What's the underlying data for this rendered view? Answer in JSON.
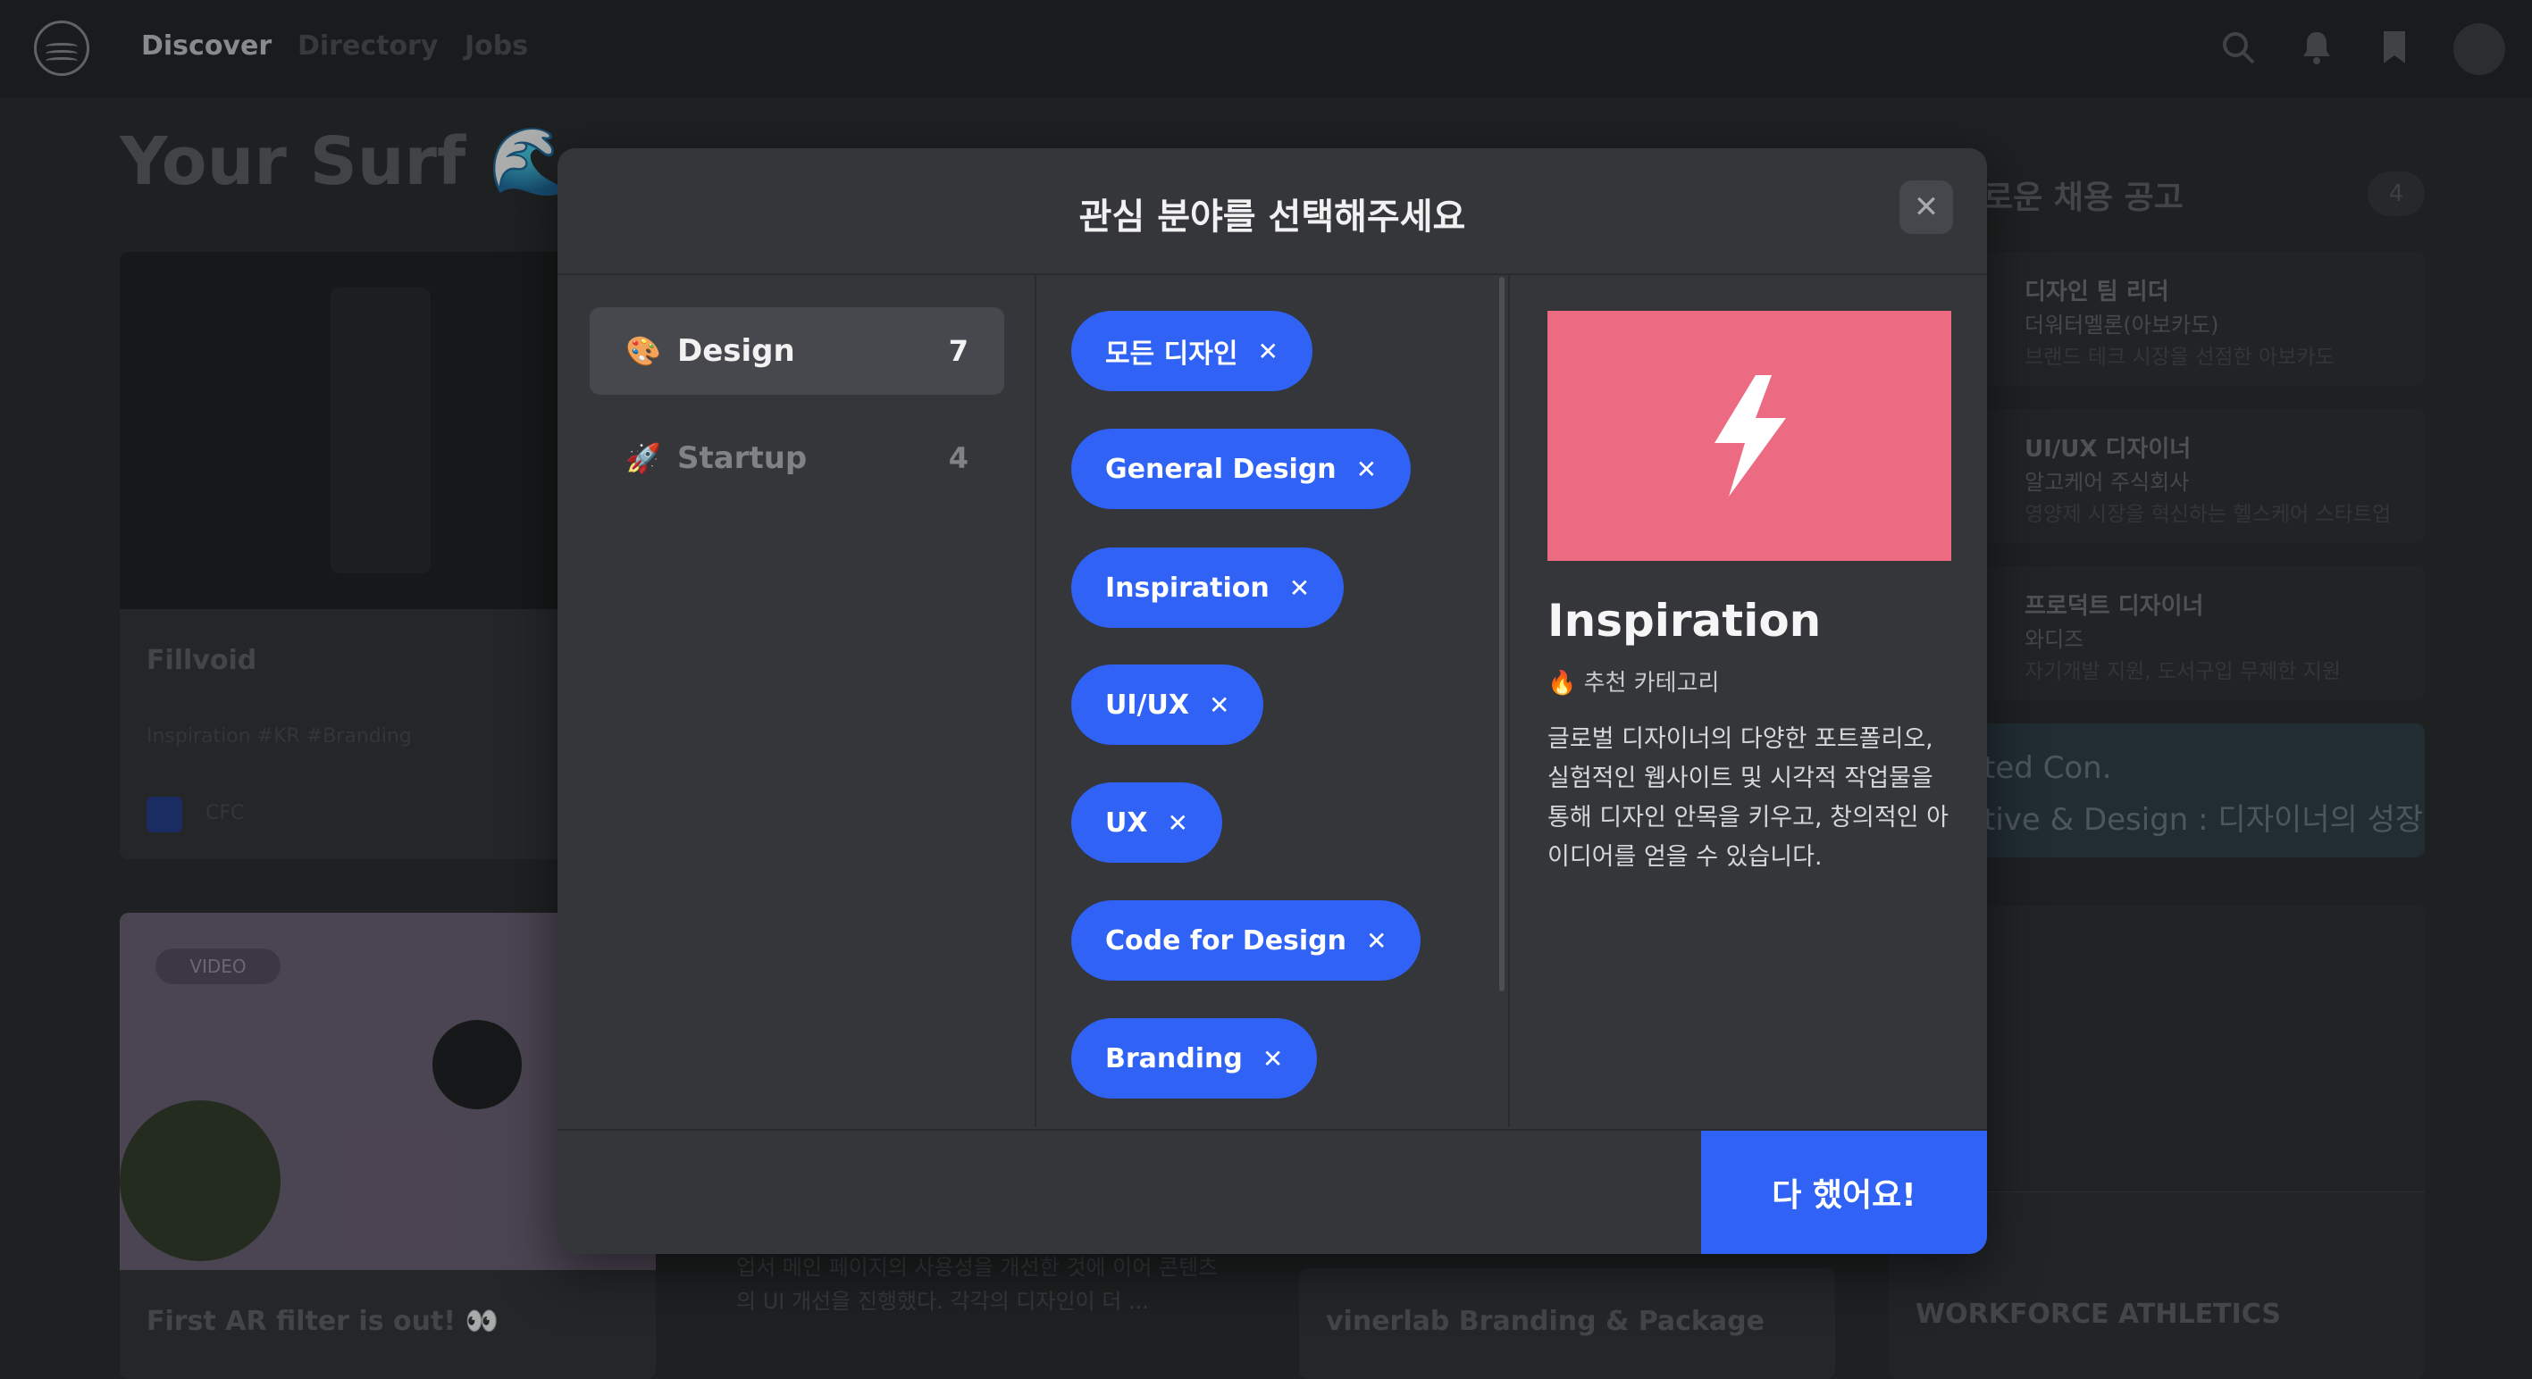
{
  "nav": {
    "items": [
      "Discover",
      "Directory",
      "Jobs"
    ]
  },
  "background": {
    "page_title": "Your Surf 🌊",
    "cards": [
      {
        "title": "Fillvoid",
        "tags": "Inspiration   #KR   #Branding",
        "source": "CFC"
      },
      {
        "title": "First AR filter is out! 👀",
        "badge": "VIDEO"
      },
      {
        "title": "vinerlab Branding & Package"
      },
      {
        "title": "WORKFORCE ATHLETICS"
      }
    ],
    "partial_text": "업서 메인 페이지의 사용성을 개선한 것에 이어 콘텐츠의 UI 개선을 진행했다. 각각의 디자인이 더 ...",
    "jobs_title": "로운 채용 공고",
    "jobs_count": "4",
    "jobs": [
      {
        "role": "디자인 팀 리더",
        "company": "더워터멜론(아보카도)",
        "desc": "브랜드 테크 시장을 선점한 아보카도"
      },
      {
        "role": "UI/UX 디자이너",
        "company": "알고케어 주식회사",
        "desc": "영양제 시장을 혁신하는 헬스케어 스타트업"
      },
      {
        "role": "프로덕트 디자이너",
        "company": "와디즈",
        "desc": "자기개발 지원, 도서구입 무제한 지원"
      }
    ],
    "banner_line1": "ted Con.",
    "banner_line2": "tive & Design : 디자이너의 성장"
  },
  "modal": {
    "title": "관심 분야를 선택해주세요",
    "categories": [
      {
        "icon": "🎨",
        "label": "Design",
        "count": "7"
      },
      {
        "icon": "🚀",
        "label": "Startup",
        "count": "4"
      }
    ],
    "chips": [
      "모든 디자인",
      "General Design",
      "Inspiration",
      "UI/UX",
      "UX",
      "Code for Design",
      "Branding"
    ],
    "detail": {
      "title": "Inspiration",
      "subtitle": "🔥 추천 카테고리",
      "description": "글로벌 디자이너의 다양한 포트폴리오, 실험적인 웹사이트 및 시각적 작업물을 통해 디자인 안목을 키우고, 창의적인 아이디어를 얻을 수 있습니다.",
      "hero_color": "#ec6b82"
    },
    "done_label": "다 했어요!"
  },
  "colors": {
    "accent": "#2f62f5",
    "modal_bg": "#34363a",
    "page_bg": "#262729"
  }
}
